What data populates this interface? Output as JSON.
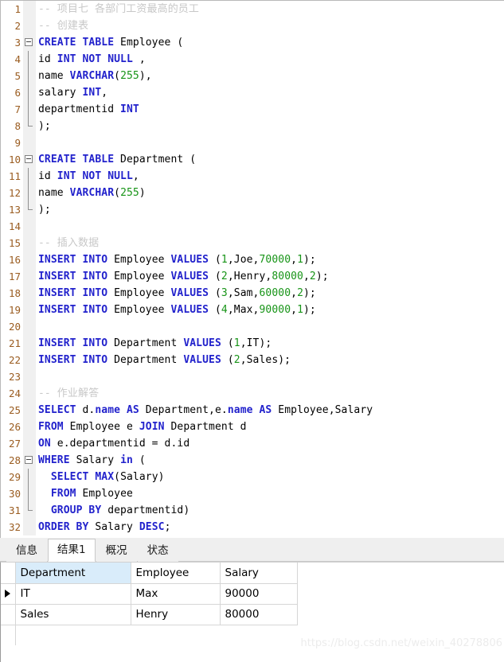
{
  "editor": {
    "language": "sql",
    "colors": {
      "keyword": "#2222cc",
      "number": "#179417",
      "comment": "#c8c8c8",
      "plain": "#000000",
      "line_number": "#9a5c20",
      "background": "#ffffff",
      "fold_gutter": "#f0f0f0"
    },
    "lines": [
      {
        "n": "1",
        "fold": "none",
        "tokens": [
          {
            "t": "cmt",
            "s": "-- 项目七 各部门工资最高的员工"
          }
        ]
      },
      {
        "n": "2",
        "fold": "none",
        "tokens": [
          {
            "t": "cmt",
            "s": "-- 创建表"
          }
        ]
      },
      {
        "n": "3",
        "fold": "start",
        "tokens": [
          {
            "t": "kw",
            "s": "CREATE TABLE"
          },
          {
            "t": "pl",
            "s": " Employee ("
          }
        ]
      },
      {
        "n": "4",
        "fold": "mid",
        "tokens": [
          {
            "t": "pl",
            "s": "id "
          },
          {
            "t": "kw",
            "s": "INT NOT NULL"
          },
          {
            "t": "pl",
            "s": " ,"
          }
        ]
      },
      {
        "n": "5",
        "fold": "mid",
        "tokens": [
          {
            "t": "pl",
            "s": "name "
          },
          {
            "t": "kw",
            "s": "VARCHAR"
          },
          {
            "t": "pl",
            "s": "("
          },
          {
            "t": "num",
            "s": "255"
          },
          {
            "t": "pl",
            "s": "),"
          }
        ]
      },
      {
        "n": "6",
        "fold": "mid",
        "tokens": [
          {
            "t": "pl",
            "s": "salary "
          },
          {
            "t": "kw",
            "s": "INT"
          },
          {
            "t": "pl",
            "s": ","
          }
        ]
      },
      {
        "n": "7",
        "fold": "mid",
        "tokens": [
          {
            "t": "pl",
            "s": "departmentid "
          },
          {
            "t": "kw",
            "s": "INT"
          }
        ]
      },
      {
        "n": "8",
        "fold": "end",
        "tokens": [
          {
            "t": "pl",
            "s": ");"
          }
        ]
      },
      {
        "n": "9",
        "fold": "none",
        "tokens": []
      },
      {
        "n": "10",
        "fold": "start",
        "tokens": [
          {
            "t": "kw",
            "s": "CREATE TABLE"
          },
          {
            "t": "pl",
            "s": " Department ("
          }
        ]
      },
      {
        "n": "11",
        "fold": "mid",
        "tokens": [
          {
            "t": "pl",
            "s": "id "
          },
          {
            "t": "kw",
            "s": "INT NOT NULL"
          },
          {
            "t": "pl",
            "s": ","
          }
        ]
      },
      {
        "n": "12",
        "fold": "mid",
        "tokens": [
          {
            "t": "pl",
            "s": "name "
          },
          {
            "t": "kw",
            "s": "VARCHAR"
          },
          {
            "t": "pl",
            "s": "("
          },
          {
            "t": "num",
            "s": "255"
          },
          {
            "t": "pl",
            "s": ")"
          }
        ]
      },
      {
        "n": "13",
        "fold": "end",
        "tokens": [
          {
            "t": "pl",
            "s": ");"
          }
        ]
      },
      {
        "n": "14",
        "fold": "none",
        "tokens": []
      },
      {
        "n": "15",
        "fold": "none",
        "tokens": [
          {
            "t": "cmt",
            "s": "-- 插入数据"
          }
        ]
      },
      {
        "n": "16",
        "fold": "none",
        "tokens": [
          {
            "t": "kw",
            "s": "INSERT INTO"
          },
          {
            "t": "pl",
            "s": " Employee "
          },
          {
            "t": "kw",
            "s": "VALUES"
          },
          {
            "t": "pl",
            "s": " ("
          },
          {
            "t": "num",
            "s": "1"
          },
          {
            "t": "pl",
            "s": ",Joe,"
          },
          {
            "t": "num",
            "s": "70000"
          },
          {
            "t": "pl",
            "s": ","
          },
          {
            "t": "num",
            "s": "1"
          },
          {
            "t": "pl",
            "s": ");"
          }
        ]
      },
      {
        "n": "17",
        "fold": "none",
        "tokens": [
          {
            "t": "kw",
            "s": "INSERT INTO"
          },
          {
            "t": "pl",
            "s": " Employee "
          },
          {
            "t": "kw",
            "s": "VALUES"
          },
          {
            "t": "pl",
            "s": " ("
          },
          {
            "t": "num",
            "s": "2"
          },
          {
            "t": "pl",
            "s": ",Henry,"
          },
          {
            "t": "num",
            "s": "80000"
          },
          {
            "t": "pl",
            "s": ","
          },
          {
            "t": "num",
            "s": "2"
          },
          {
            "t": "pl",
            "s": ");"
          }
        ]
      },
      {
        "n": "18",
        "fold": "none",
        "tokens": [
          {
            "t": "kw",
            "s": "INSERT INTO"
          },
          {
            "t": "pl",
            "s": " Employee "
          },
          {
            "t": "kw",
            "s": "VALUES"
          },
          {
            "t": "pl",
            "s": " ("
          },
          {
            "t": "num",
            "s": "3"
          },
          {
            "t": "pl",
            "s": ",Sam,"
          },
          {
            "t": "num",
            "s": "60000"
          },
          {
            "t": "pl",
            "s": ","
          },
          {
            "t": "num",
            "s": "2"
          },
          {
            "t": "pl",
            "s": ");"
          }
        ]
      },
      {
        "n": "19",
        "fold": "none",
        "tokens": [
          {
            "t": "kw",
            "s": "INSERT INTO"
          },
          {
            "t": "pl",
            "s": " Employee "
          },
          {
            "t": "kw",
            "s": "VALUES"
          },
          {
            "t": "pl",
            "s": " ("
          },
          {
            "t": "num",
            "s": "4"
          },
          {
            "t": "pl",
            "s": ",Max,"
          },
          {
            "t": "num",
            "s": "90000"
          },
          {
            "t": "pl",
            "s": ","
          },
          {
            "t": "num",
            "s": "1"
          },
          {
            "t": "pl",
            "s": ");"
          }
        ]
      },
      {
        "n": "20",
        "fold": "none",
        "tokens": []
      },
      {
        "n": "21",
        "fold": "none",
        "tokens": [
          {
            "t": "kw",
            "s": "INSERT INTO"
          },
          {
            "t": "pl",
            "s": " Department "
          },
          {
            "t": "kw",
            "s": "VALUES"
          },
          {
            "t": "pl",
            "s": " ("
          },
          {
            "t": "num",
            "s": "1"
          },
          {
            "t": "pl",
            "s": ",IT);"
          }
        ]
      },
      {
        "n": "22",
        "fold": "none",
        "tokens": [
          {
            "t": "kw",
            "s": "INSERT INTO"
          },
          {
            "t": "pl",
            "s": " Department "
          },
          {
            "t": "kw",
            "s": "VALUES"
          },
          {
            "t": "pl",
            "s": " ("
          },
          {
            "t": "num",
            "s": "2"
          },
          {
            "t": "pl",
            "s": ",Sales);"
          }
        ]
      },
      {
        "n": "23",
        "fold": "none",
        "tokens": []
      },
      {
        "n": "24",
        "fold": "none",
        "tokens": [
          {
            "t": "cmt",
            "s": "-- 作业解答"
          }
        ]
      },
      {
        "n": "25",
        "fold": "none",
        "tokens": [
          {
            "t": "kw",
            "s": "SELECT"
          },
          {
            "t": "pl",
            "s": " d."
          },
          {
            "t": "kw",
            "s": "name"
          },
          {
            "t": "pl",
            "s": " "
          },
          {
            "t": "kw",
            "s": "AS"
          },
          {
            "t": "pl",
            "s": " Department,e."
          },
          {
            "t": "kw",
            "s": "name"
          },
          {
            "t": "pl",
            "s": " "
          },
          {
            "t": "kw",
            "s": "AS"
          },
          {
            "t": "pl",
            "s": " Employee,Salary"
          }
        ]
      },
      {
        "n": "26",
        "fold": "none",
        "tokens": [
          {
            "t": "kw",
            "s": "FROM"
          },
          {
            "t": "pl",
            "s": " Employee e "
          },
          {
            "t": "kw",
            "s": "JOIN"
          },
          {
            "t": "pl",
            "s": " Department d"
          }
        ]
      },
      {
        "n": "27",
        "fold": "none",
        "tokens": [
          {
            "t": "kw",
            "s": "ON"
          },
          {
            "t": "pl",
            "s": " e.departmentid = d.id"
          }
        ]
      },
      {
        "n": "28",
        "fold": "start",
        "tokens": [
          {
            "t": "kw",
            "s": "WHERE"
          },
          {
            "t": "pl",
            "s": " Salary "
          },
          {
            "t": "kw",
            "s": "in"
          },
          {
            "t": "pl",
            "s": " ("
          }
        ]
      },
      {
        "n": "29",
        "fold": "mid",
        "tokens": [
          {
            "t": "pl",
            "s": "  "
          },
          {
            "t": "kw",
            "s": "SELECT MAX"
          },
          {
            "t": "pl",
            "s": "(Salary)"
          }
        ]
      },
      {
        "n": "30",
        "fold": "mid",
        "tokens": [
          {
            "t": "pl",
            "s": "  "
          },
          {
            "t": "kw",
            "s": "FROM"
          },
          {
            "t": "pl",
            "s": " Employee"
          }
        ]
      },
      {
        "n": "31",
        "fold": "end",
        "tokens": [
          {
            "t": "pl",
            "s": "  "
          },
          {
            "t": "kw",
            "s": "GROUP BY"
          },
          {
            "t": "pl",
            "s": " departmentid)"
          }
        ]
      },
      {
        "n": "32",
        "fold": "none",
        "tokens": [
          {
            "t": "kw",
            "s": "ORDER BY"
          },
          {
            "t": "pl",
            "s": " Salary "
          },
          {
            "t": "kw",
            "s": "DESC"
          },
          {
            "t": "pl",
            "s": ";"
          }
        ]
      }
    ]
  },
  "bottom_panel": {
    "tabs": [
      {
        "label": "信息",
        "active": false,
        "name": "tab-info"
      },
      {
        "label": "结果1",
        "active": true,
        "name": "tab-result1"
      },
      {
        "label": "概况",
        "active": false,
        "name": "tab-profile"
      },
      {
        "label": "状态",
        "active": false,
        "name": "tab-status"
      }
    ],
    "result_grid": {
      "columns": [
        {
          "label": "Department",
          "selected": true,
          "align": "left"
        },
        {
          "label": "Employee",
          "selected": false,
          "align": "left"
        },
        {
          "label": "Salary",
          "selected": false,
          "align": "right"
        }
      ],
      "rows": [
        {
          "current": true,
          "cells": [
            "IT",
            "Max",
            "90000"
          ]
        },
        {
          "current": false,
          "cells": [
            "Sales",
            "Henry",
            "80000"
          ]
        }
      ],
      "header_selected_color": "#d9ecfa"
    }
  },
  "watermark": {
    "text": "https://blog.csdn.net/weixin_40278806"
  }
}
